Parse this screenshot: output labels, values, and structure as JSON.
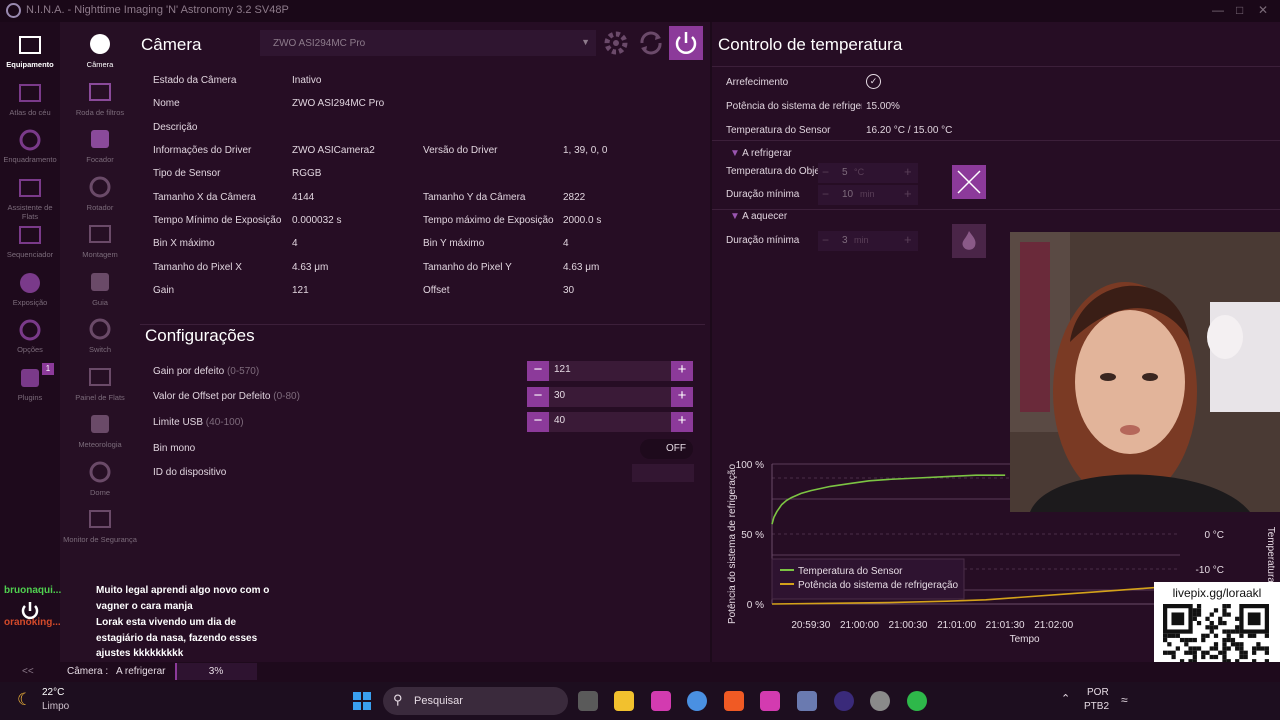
{
  "window": {
    "title": "N.I.N.A. - Nighttime Imaging 'N' Astronomy 3.2    SV48P"
  },
  "rail_main": [
    {
      "label": "Equipamento",
      "icon": "equipment-icon",
      "active": true
    },
    {
      "label": "Atlas do céu",
      "icon": "sky-atlas-icon"
    },
    {
      "label": "Enquadramento",
      "icon": "framing-icon"
    },
    {
      "label": "Assistente de Flats",
      "icon": "flat-wizard-icon"
    },
    {
      "label": "Sequenciador",
      "icon": "sequencer-icon"
    },
    {
      "label": "Exposição",
      "icon": "imaging-icon"
    },
    {
      "label": "Opções",
      "icon": "options-icon"
    },
    {
      "label": "Plugins",
      "icon": "plugins-icon",
      "badge": "1"
    }
  ],
  "rail_equipment": [
    {
      "label": "Câmera",
      "icon": "camera-shutter-icon"
    },
    {
      "label": "Roda de filtros",
      "icon": "filter-wheel-icon"
    },
    {
      "label": "Focador",
      "icon": "focuser-icon"
    },
    {
      "label": "Rotador",
      "icon": "rotator-icon"
    },
    {
      "label": "Montagem",
      "icon": "telescope-icon"
    },
    {
      "label": "Guia",
      "icon": "guider-icon"
    },
    {
      "label": "Switch",
      "icon": "switch-icon"
    },
    {
      "label": "Painel de Flats",
      "icon": "flat-panel-icon"
    },
    {
      "label": "Meteorologia",
      "icon": "weather-icon"
    },
    {
      "label": "Dome",
      "icon": "dome-icon"
    },
    {
      "label": "Monitor de Segurança",
      "icon": "safety-monitor-icon"
    }
  ],
  "camera": {
    "title": "Câmera",
    "device": "ZWO ASI294MC Pro",
    "info": {
      "estado_label": "Estado da Câmera",
      "estado": "Inativo",
      "nome_label": "Nome",
      "nome": "ZWO ASI294MC Pro",
      "descricao_label": "Descrição",
      "driverinfo_label": "Informações do Driver",
      "driverinfo": "ZWO ASICamera2",
      "driverver_label": "Versão do Driver",
      "driverver": "1, 39, 0, 0",
      "sensor_label": "Tipo de Sensor",
      "sensor": "RGGB",
      "sizex_label": "Tamanho X da Câmera",
      "sizex": "4144",
      "sizey_label": "Tamanho Y da Câmera",
      "sizey": "2822",
      "minexp_label": "Tempo Mínimo de Exposição",
      "minexp": "0.000032 s",
      "maxexp_label": "Tempo máximo de Exposição",
      "maxexp": "2000.0 s",
      "binx_label": "Bin X máximo",
      "binx": "4",
      "biny_label": "Bin Y máximo",
      "biny": "4",
      "pixx_label": "Tamanho do Pixel X",
      "pixx": "4.63 μm",
      "pixy_label": "Tamanho do Pixel Y",
      "pixy": "4.63 μm",
      "gain_label": "Gain",
      "gain": "121",
      "offset_label": "Offset",
      "offset": "30"
    },
    "settings": {
      "title": "Configurações",
      "gain_label": "Gain por defeito",
      "gain_range": "(0-570)",
      "gain": "121",
      "offset_label": "Valor de Offset por Defeito",
      "offset_range": "(0-80)",
      "offset": "30",
      "usb_label": "Limite USB",
      "usb_range": "(40-100)",
      "usb": "40",
      "binmono_label": "Bin mono",
      "binmono": "OFF",
      "deviceid_label": "ID do dispositivo"
    }
  },
  "temperature": {
    "title": "Controlo de temperatura",
    "cooling_label": "Arrefecimento",
    "power_label": "Potência do sistema de refrigeração",
    "power": "15.00%",
    "sensor_label": "Temperatura do Sensor",
    "sensor": "16.20 °C /  15.00 °C",
    "cooling_section": "A refrigerar",
    "target_label": "Temperatura do Objetivo",
    "target": "5",
    "target_unit": "°C",
    "mindur_label": "Duração mínima",
    "mindur": "10",
    "mindur_unit": "min",
    "warming_section": "A aquecer",
    "warm_mindur_label": "Duração mínima",
    "warm_mindur": "3",
    "warm_mindur_unit": "min"
  },
  "chart_data": {
    "type": "line",
    "ylabel": "Potência do sistema de refrigeração",
    "y2label": "Temperatura do Sensor",
    "xlabel": "Tempo",
    "y_ticks": [
      "100 %",
      "50 %",
      "0 %"
    ],
    "y2_ticks": [
      "0 °C",
      "-10 °C"
    ],
    "x_ticks": [
      "20:59:30",
      "21:00:00",
      "21:00:30",
      "21:01:00",
      "21:01:30",
      "21:02:00"
    ],
    "ylim": [
      0,
      100
    ],
    "legend_position": "bottom-left",
    "series": [
      {
        "name": "Temperatura do Sensor",
        "color": "#7cc443",
        "x": [
          0,
          2,
          5,
          10,
          15,
          20,
          30,
          40,
          60,
          80,
          100,
          120,
          150,
          180,
          210,
          240
        ],
        "y": [
          57,
          62,
          66,
          71,
          74,
          76,
          79,
          81,
          84,
          86,
          88,
          89,
          90,
          91,
          92,
          92
        ]
      },
      {
        "name": "Potência do sistema de refrigeração",
        "color": "#d4a21a",
        "x": [
          0,
          60,
          120,
          180,
          220,
          260,
          300,
          340,
          380,
          400
        ],
        "y": [
          0,
          0.5,
          1,
          2,
          3,
          5,
          7,
          9,
          11,
          12
        ]
      }
    ]
  },
  "status": {
    "back": "<<",
    "camera_label": "Câmera :",
    "camera_state": "A refrigerar",
    "progress": "3%",
    "progress_value": 3
  },
  "chat": [
    {
      "user": "bruonaqui...",
      "text": "Muito legal aprendi algo novo com o"
    },
    {
      "user": "",
      "text": "vagner o cara manja"
    },
    {
      "user": "oranoking...",
      "text": "Lorak esta vivendo um dia de"
    },
    {
      "user": "",
      "text": "estagiário da nasa, fazendo esses"
    },
    {
      "user": "",
      "text": "ajustes kkkkkkkkk"
    }
  ],
  "qr": {
    "caption": "livepix.gg/loraakl"
  },
  "taskbar": {
    "weather_temp": "22°C",
    "weather_desc": "Limpo",
    "search": "Pesquisar",
    "lang1": "POR",
    "lang2": "PTB2"
  }
}
